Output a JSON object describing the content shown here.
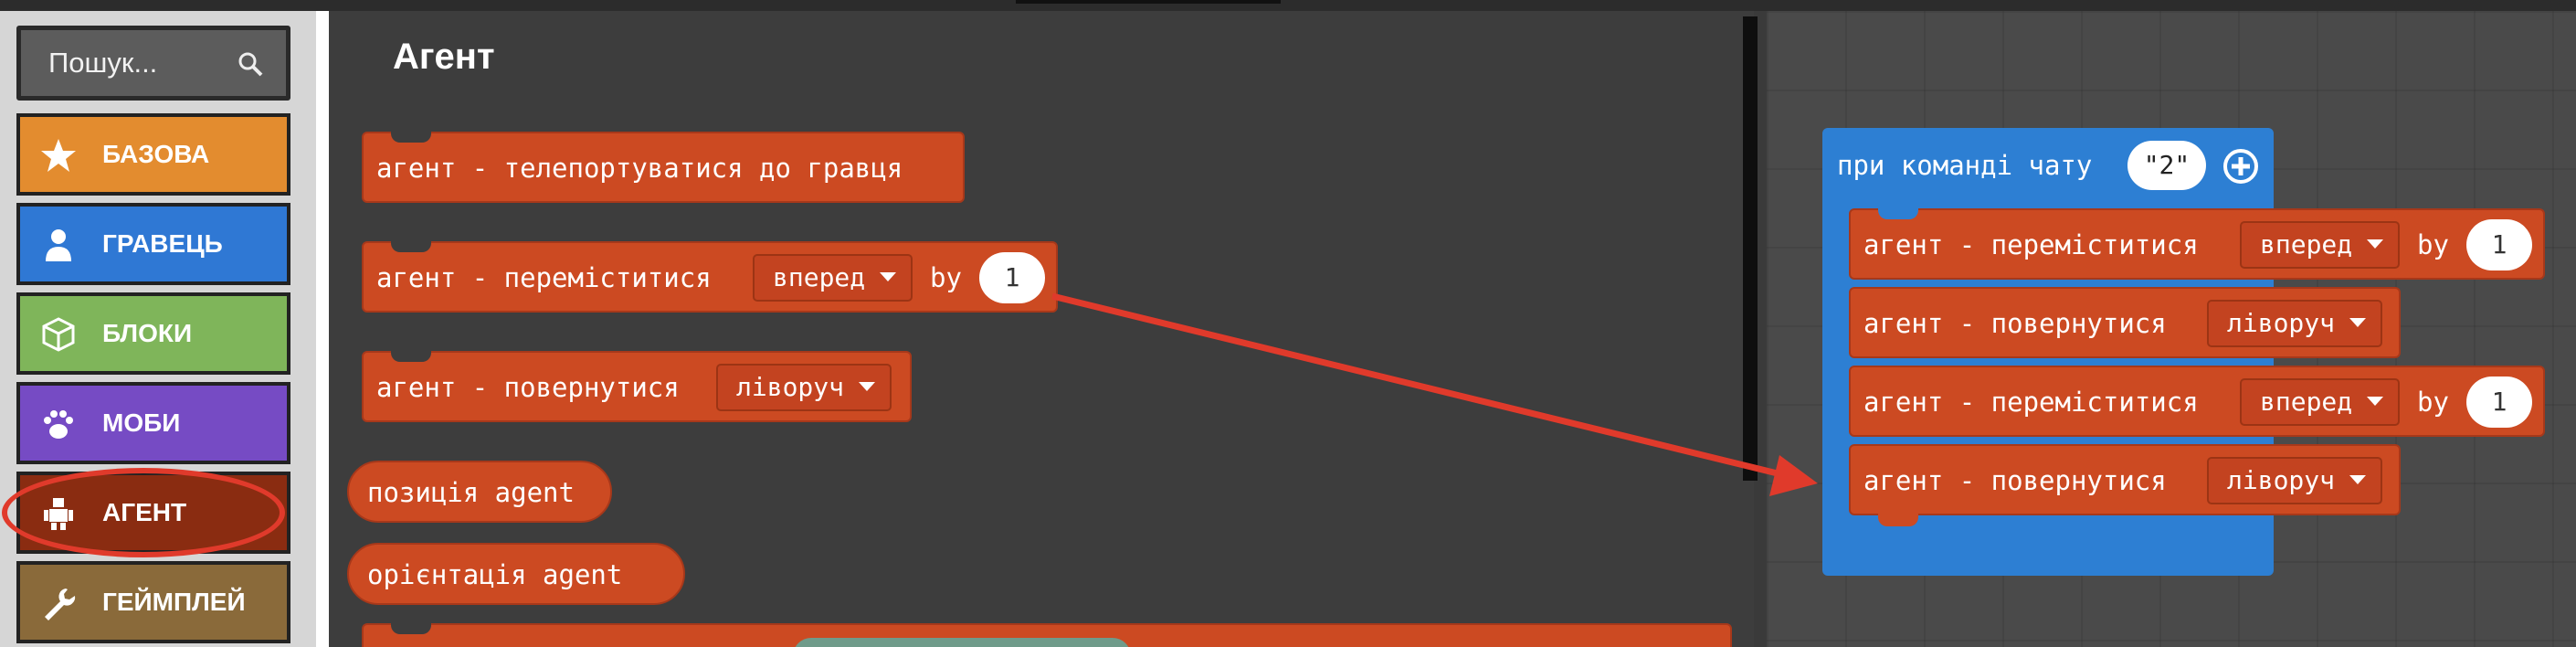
{
  "search": {
    "placeholder": "Пошук..."
  },
  "categories": [
    {
      "label": "БАЗОВА",
      "icon": "star-icon",
      "color": "#e38c2f"
    },
    {
      "label": "ГРАВЕЦЬ",
      "icon": "person-icon",
      "color": "#2f78d4"
    },
    {
      "label": "БЛОКИ",
      "icon": "cube-icon",
      "color": "#7fb55a"
    },
    {
      "label": "МОБИ",
      "icon": "paw-icon",
      "color": "#764bc4"
    },
    {
      "label": "АГЕНТ",
      "icon": "robot-icon",
      "color": "#8a2c11"
    },
    {
      "label": "ГЕЙМПЛЕЙ",
      "icon": "wrench-icon",
      "color": "#8a6a3a"
    }
  ],
  "flyout": {
    "title": "Агент",
    "blocks": {
      "teleport": "агент - телепортуватися до гравця",
      "move": "агент - переміститися",
      "move_dir": "вперед",
      "move_by": "by",
      "move_steps": "1",
      "turn": "агент - повернутися",
      "turn_dir": "ліворуч",
      "position": "позиція agent",
      "orientation": "орієнтація agent"
    }
  },
  "workspace": {
    "event_label": "при команді чату",
    "event_value": "\"2\"",
    "stack": [
      {
        "text": "агент - переміститися",
        "dropdown": "вперед",
        "by": "by",
        "value": "1"
      },
      {
        "text": "агент - повернутися",
        "dropdown": "ліворуч"
      },
      {
        "text": "агент - переміститися",
        "dropdown": "вперед",
        "by": "by",
        "value": "1"
      },
      {
        "text": "агент - повернутися",
        "dropdown": "ліворуч"
      }
    ]
  },
  "colors": {
    "agent_block": "#cc4a22",
    "event_block": "#2d7fd3",
    "annotation": "#e03a2b"
  }
}
